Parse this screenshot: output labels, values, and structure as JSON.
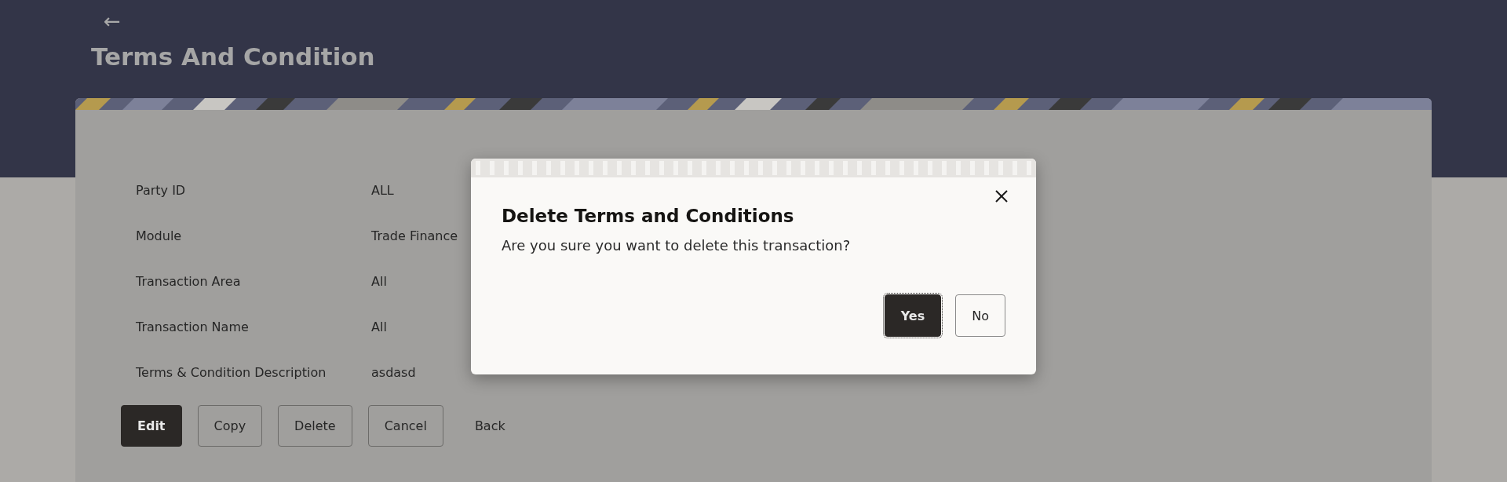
{
  "header": {
    "back_icon": "←",
    "title": "Terms And Condition"
  },
  "details": [
    {
      "label": "Party ID",
      "value": "ALL"
    },
    {
      "label": "Module",
      "value": "Trade Finance"
    },
    {
      "label": "Transaction Area",
      "value": "All"
    },
    {
      "label": "Transaction Name",
      "value": "All"
    },
    {
      "label": "Terms & Condition Description",
      "value": "asdasd"
    }
  ],
  "actions": [
    {
      "label": "Edit",
      "kind": "primary"
    },
    {
      "label": "Copy",
      "kind": "secondary"
    },
    {
      "label": "Delete",
      "kind": "secondary"
    },
    {
      "label": "Cancel",
      "kind": "secondary"
    },
    {
      "label": "Back",
      "kind": "link"
    }
  ],
  "dialog": {
    "title": "Delete Terms and Conditions",
    "message": "Are you sure you want to delete this transaction?",
    "buttons": [
      {
        "label": "Yes",
        "kind": "primary"
      },
      {
        "label": "No",
        "kind": "secondary"
      }
    ]
  }
}
